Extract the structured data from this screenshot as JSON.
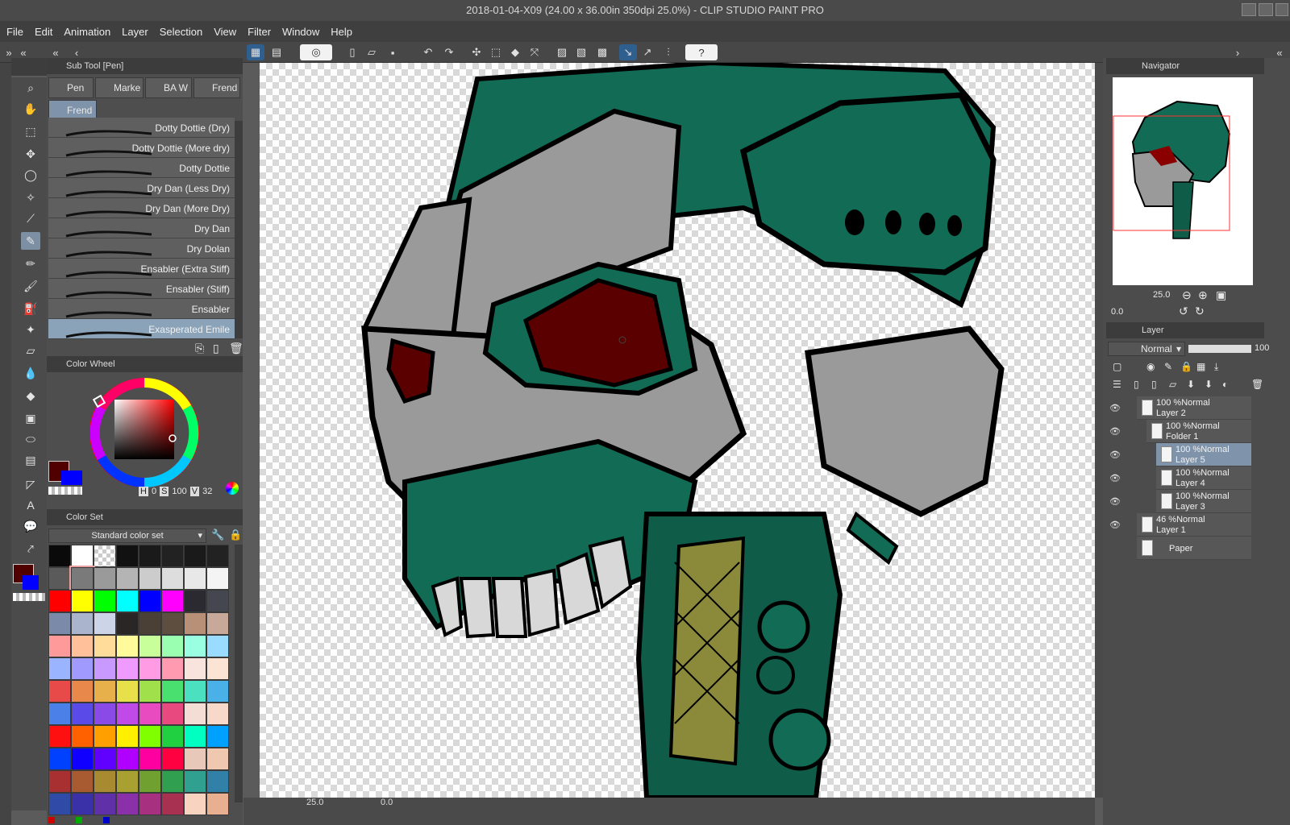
{
  "window": {
    "title": "2018-01-04-X09 (24.00 x 36.00in 350dpi 25.0%)  - CLIP STUDIO PAINT PRO"
  },
  "menu": [
    "File",
    "Edit",
    "Animation",
    "Layer",
    "Selection",
    "View",
    "Filter",
    "Window",
    "Help"
  ],
  "subtool": {
    "panel_title": "Sub Tool [Pen]",
    "tabs": [
      "Pen",
      "Marke",
      "BA W",
      "Frend"
    ],
    "selected_tab": "Frend",
    "brushes": [
      "Dotty Dottie (Dry)",
      "Dotty Dottie (More dry)",
      "Dotty Dottie",
      "Dry Dan (Less Dry)",
      "Dry Dan (More Dry)",
      "Dry Dan",
      "Dry Dolan",
      "Ensabler (Extra Stiff)",
      "Ensabler (Stiff)",
      "Ensabler",
      "Exasperated Emile"
    ]
  },
  "colorwheel": {
    "panel_title": "Color Wheel",
    "h_label": "H",
    "h": "0",
    "s_label": "S",
    "s": "100",
    "v_label": "V",
    "v": "32",
    "main_color": "#510000",
    "sub_color": "#0000ff"
  },
  "colorset": {
    "panel_title": "Color Set",
    "set_name": "Standard color set",
    "rows": [
      [
        "#0a0a0a",
        "#ffffff",
        "checker",
        "#111111",
        "#1a1a1a",
        "#222222",
        "#1a1a1a",
        "#222222"
      ],
      [
        "#5a5a5a",
        "#7a7a7a",
        "#9a9a9a",
        "#b4b4b4",
        "#cccccc",
        "#dddddd",
        "#e8e8e8",
        "#f4f4f4"
      ],
      [
        "#ff0000",
        "#ffff00",
        "#00ff00",
        "#00ffff",
        "#0000ff",
        "#ff00ff",
        "#2a2a30",
        "#444650"
      ],
      [
        "#7a8aa8",
        "#aab4cc",
        "#ccd4e8",
        "#2a2626",
        "#4a4036",
        "#5e4e40",
        "#b89078",
        "#c8a898"
      ],
      [
        "#ff9a9a",
        "#ffc09a",
        "#ffdc9a",
        "#fffa9a",
        "#c8ff9a",
        "#9affb0",
        "#9affe0",
        "#9adcff"
      ],
      [
        "#9ab4ff",
        "#a09aff",
        "#c89aff",
        "#ee9aff",
        "#ff9ae4",
        "#ff9ab0",
        "#f8e4dc",
        "#fce4d4"
      ],
      [
        "#e84a4a",
        "#e8884a",
        "#e8b04a",
        "#e8e04a",
        "#a0e04a",
        "#4ae070",
        "#4ae0c0",
        "#4ab0e8"
      ],
      [
        "#4a80e8",
        "#5a4ae8",
        "#8a4ae8",
        "#c04ae8",
        "#e84ac0",
        "#e84a80",
        "#f4ddd4",
        "#f8d8c8"
      ],
      [
        "#ff1010",
        "#ff6000",
        "#ffa000",
        "#fff000",
        "#80ff00",
        "#20d040",
        "#00ffc0",
        "#00a0ff"
      ],
      [
        "#0040ff",
        "#1000ff",
        "#6000ff",
        "#b000ff",
        "#ff00a0",
        "#ff0040",
        "#e8c8b8",
        "#f0c8b0"
      ],
      [
        "#a83030",
        "#a85a30",
        "#a88a30",
        "#a8a030",
        "#70a030",
        "#30a050",
        "#30a090",
        "#3080a8"
      ],
      [
        "#304aa8",
        "#3a30a8",
        "#6030a8",
        "#8a30a8",
        "#a83080",
        "#a83050",
        "#f8d4c0",
        "#e8b090"
      ]
    ]
  },
  "status": {
    "zoom": "25.0",
    "angle": "0.0"
  },
  "navigator": {
    "panel_title": "Navigator",
    "zoom": "25.0",
    "angle": "0.0"
  },
  "layer_panel": {
    "panel_title": "Layer",
    "blend_mode": "Normal",
    "opacity": "100",
    "layers": [
      {
        "line1": "100 %Normal",
        "line2": "Layer 2",
        "indent": 0,
        "selected": false
      },
      {
        "line1": "100 %Normal",
        "line2": "Folder 1",
        "indent": 1,
        "selected": false
      },
      {
        "line1": "100 %Normal",
        "line2": "Layer 5",
        "indent": 2,
        "selected": true
      },
      {
        "line1": "100 %Normal",
        "line2": "Layer 4",
        "indent": 2,
        "selected": false
      },
      {
        "line1": "100 %Normal",
        "line2": "Layer 3",
        "indent": 2,
        "selected": false
      },
      {
        "line1": "46 %Normal",
        "line2": "Layer 1",
        "indent": 0,
        "selected": false
      },
      {
        "line1": "",
        "line2": "Paper",
        "indent": 0,
        "selected": false
      }
    ]
  },
  "colors": {
    "accent_selection": "#7f94ab",
    "panel_bg": "#4e4e4e",
    "skull_green": "#116b55",
    "skull_gray": "#9a9a9a",
    "eye_red": "#5a0000"
  }
}
